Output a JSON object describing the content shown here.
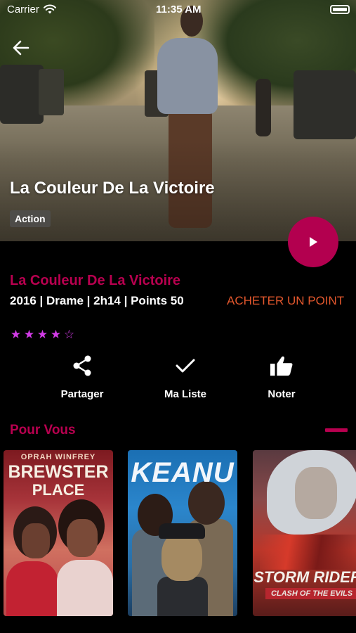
{
  "status_bar": {
    "carrier": "Carrier",
    "time": "11:35 AM"
  },
  "hero": {
    "title": "La Couleur De La Victoire",
    "genre_tag": "Action"
  },
  "details": {
    "title": "La Couleur De La Victoire",
    "meta": "2016 | Drame | 2h14 | Points 50",
    "buy_label": "ACHETER UN POINT",
    "rating": 4,
    "rating_max": 5,
    "stars": [
      "★",
      "★",
      "★",
      "★",
      "☆"
    ]
  },
  "actions": {
    "share_label": "Partager",
    "list_label": "Ma Liste",
    "rate_label": "Noter"
  },
  "section": {
    "title": "Pour Vous"
  },
  "posters": [
    {
      "top_line": "OPRAH WINFREY",
      "title_line1": "BREWSTER",
      "title_line2": "PLACE"
    },
    {
      "title": "KEANU"
    },
    {
      "title": "STORM RIDER",
      "subtitle": "CLASH OF THE EVILS"
    }
  ],
  "colors": {
    "accent": "#b8004f",
    "buy_link": "#e2572d",
    "stars": "#d13be6",
    "background": "#000000"
  },
  "icons": {
    "back": "arrow-left-icon",
    "play": "play-icon",
    "share": "share-icon",
    "list": "checkmark-icon",
    "rate": "thumbs-up-icon",
    "wifi": "wifi-icon",
    "battery": "battery-icon"
  }
}
